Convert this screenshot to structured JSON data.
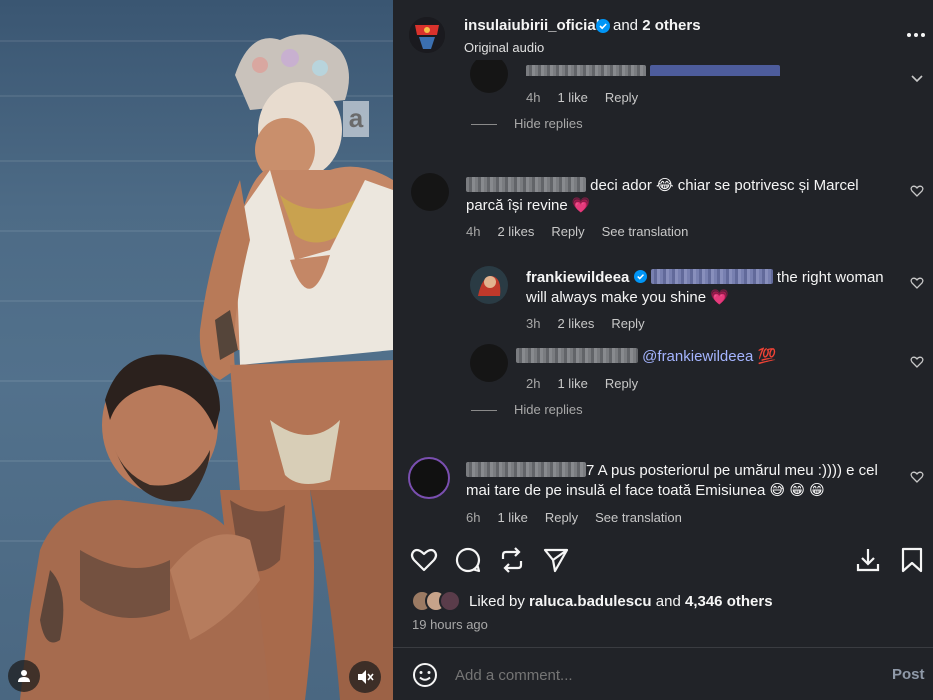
{
  "header": {
    "username": "insulaiubirii_oficial",
    "others_prefix": "and",
    "others_count": "2 others",
    "audio": "Original audio"
  },
  "comments": {
    "c0": {
      "time": "4h",
      "likes": "1 like",
      "reply": "Reply"
    },
    "hide1": "Hide replies",
    "c1": {
      "line1": "deci ador 😂 chiar se potrivesc și Marcel",
      "line2": "parcă își revine 💗",
      "time": "4h",
      "likes": "2 likes",
      "reply": "Reply",
      "translate": "See translation"
    },
    "c2": {
      "username": "frankiewildeea",
      "line1_rest": "the right woman",
      "line2": "will always make you shine 💗",
      "time": "3h",
      "likes": "2 likes",
      "reply": "Reply"
    },
    "c3": {
      "mention": "@frankiewildeea 💯",
      "time": "2h",
      "likes": "1 like",
      "reply": "Reply"
    },
    "hide2": "Hide replies",
    "c4": {
      "line1": "7 A pus posteriorul pe umărul meu :)))) e cel",
      "line2": "mai tare de pe insulă el face toată Emisiunea 😅 😁 😁",
      "time": "6h",
      "likes": "1 like",
      "reply": "Reply",
      "translate": "See translation"
    }
  },
  "likes": {
    "prefix": "Liked by",
    "user": "raluca.badulescu",
    "middle": "and",
    "count": "4,346 others",
    "time_ago": "19 hours ago"
  },
  "comment_box": {
    "placeholder": "Add a comment...",
    "post_label": "Post"
  },
  "media": {
    "watermark": "a"
  },
  "colors": {
    "panel_bg": "#212328",
    "text": "#f5f5f5",
    "muted": "#a8a8a8",
    "mention": "#a4b4ff",
    "verified": "#0095f6",
    "post": "#8f99a8"
  }
}
